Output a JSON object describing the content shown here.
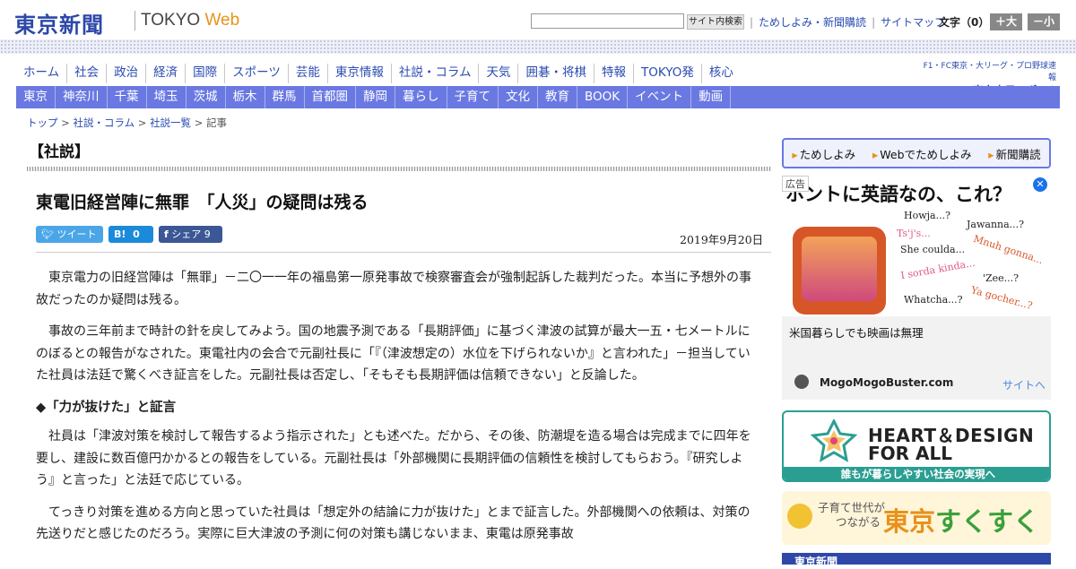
{
  "header": {
    "logo_ja": "東京新聞",
    "logo_en_1": "TOKYO",
    "logo_en_2": "Web",
    "search_placeholder": "",
    "search_button": "サイト内検索",
    "links": [
      "ためしよみ・新聞購読",
      "サイトマップ"
    ],
    "font_label": "文字（0）",
    "font_bigger": "＋大",
    "font_smaller": "－小"
  },
  "nav_primary": [
    "ホーム",
    "社会",
    "政治",
    "経済",
    "国際",
    "スポーツ",
    "芸能",
    "東京情報",
    "社説・コラム",
    "天気",
    "囲碁・将棋",
    "特報",
    "TOKYO発",
    "核心"
  ],
  "chunichi": {
    "tagline": "F1・FC東京・大リーグ・プロ野球速報",
    "name": "東京中日スポーツ"
  },
  "nav_secondary": [
    "東京",
    "神奈川",
    "千葉",
    "埼玉",
    "茨城",
    "栃木",
    "群馬",
    "首都圏",
    "静岡",
    "暮らし",
    "子育て",
    "文化",
    "教育",
    "BOOK",
    "イベント",
    "動画"
  ],
  "breadcrumb": {
    "items": [
      "トップ",
      "社説・コラム",
      "社説一覧"
    ],
    "current": "記事",
    "sep": " > "
  },
  "article": {
    "section": "【社説】",
    "title": "東電旧経営陣に無罪　「人災」の疑問は残る",
    "date": "2019年9月20日",
    "share": {
      "tweet": "ツイート",
      "hatena_label": "B!",
      "hatena_count": "0",
      "fb_label": "シェア",
      "fb_count": "9"
    },
    "paragraphs": [
      "東京電力の旧経営陣は「無罪」－二〇一一年の福島第一原発事故で検察審査会が強制起訴した裁判だった。本当に予想外の事故だったのか疑問は残る。",
      "事故の三年前まで時計の針を戻してみよう。国の地震予測である「長期評価」に基づく津波の試算が最大一五・七メートルにのぼるとの報告がなされた。東電社内の会合で元副社長に「『（津波想定の）水位を下げられないか』と言われた」－担当していた社員は法廷で驚くべき証言をした。元副社長は否定し、「そもそも長期評価は信頼できない」と反論した。"
    ],
    "subheading": "◆「力が抜けた」と証言",
    "paragraphs2": [
      "社員は「津波対策を検討して報告するよう指示された」とも述べた。だから、その後、防潮堤を造る場合は完成までに四年を要し、建設に数百億円かかるとの報告をしている。元副社長は「外部機関に長期評価の信頼性を検討してもらおう。『研究しよう』と言った」と法廷で応じている。",
      "てっきり対策を進める方向と思っていた社員は「想定外の結論に力が抜けた」とまで証言した。外部機関への依頼は、対策の先送りだと感じたのだろう。実際に巨大津波の予測に何の対策も講じないまま、東電は原発事故"
    ]
  },
  "sidebar": {
    "sub_links": [
      "ためしよみ",
      "Webでためしよみ",
      "新聞購読"
    ],
    "ad": {
      "badge": "広告",
      "headline": "ホントに英語なの、これ？",
      "close": "✕",
      "bubbles": [
        "Howja...?",
        "Jawanna...?",
        "Ts'j's...",
        "She coulda...",
        "Mnuh gonna...",
        "I sorda kinda...",
        "'Zee...?",
        "Whatcha...?",
        "Ya gocher...?"
      ],
      "caption": "米国暮らしでも映画は無理",
      "advertiser": "MogoMogoBuster.com",
      "site_link": "サイトへ"
    },
    "banner_heart": {
      "line1": "HEART＆DESIGN",
      "line2": "FOR ALL",
      "footer": "誰もが暮らしやすい社会の実現へ"
    },
    "banner_sukusuku": {
      "line1": "子育て世代が",
      "line2": "つながる",
      "brand_1": "東京",
      "brand_2": "すくすく"
    },
    "banner_shimbun": {
      "text": "東京新聞"
    }
  }
}
